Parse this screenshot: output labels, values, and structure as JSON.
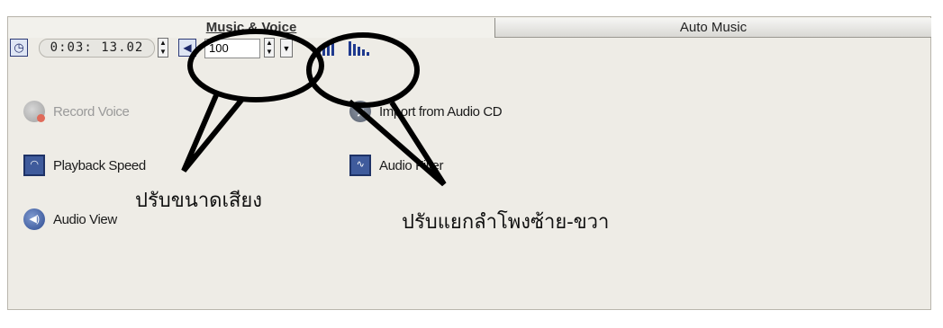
{
  "tabs": {
    "music_voice": "Music & Voice",
    "auto_music": "Auto Music"
  },
  "toolbar": {
    "timecode": "0:03: 13.02",
    "volume": "100"
  },
  "actions": {
    "record_voice": "Record Voice",
    "import_cd": "Import from Audio CD",
    "playback_speed": "Playback Speed",
    "audio_filter": "Audio Filter",
    "audio_view": "Audio View"
  },
  "annotations": {
    "volume_note": "ปรับขนาดเสียง",
    "balance_note": "ปรับแยกลำโพงซ้าย-ขวา"
  },
  "icons": {
    "clock": "clock-icon",
    "volume": "speaker-icon",
    "balance_left": "bars-rising-icon",
    "balance_right": "bars-falling-icon"
  },
  "colors": {
    "panel_bg": "#eeece6",
    "icon_blue": "#1f3a8f",
    "disabled_text": "#9a9a9a"
  }
}
